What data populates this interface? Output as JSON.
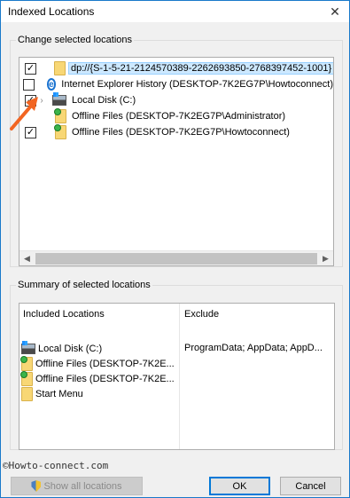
{
  "window": {
    "title": "Indexed Locations",
    "close_glyph": "✕"
  },
  "change_group": {
    "legend": "Change selected locations",
    "items": [
      {
        "checked": true,
        "icon": "folder-icon",
        "label": "dp://{S-1-5-21-2124570389-2262693850-2768397452-1001}",
        "selected": true
      },
      {
        "checked": false,
        "icon": "internet-explorer-icon",
        "label": "Internet Explorer History (DESKTOP-7K2EG7P\\Howtoconnect)"
      },
      {
        "checked": true,
        "icon": "local-disk-icon",
        "label": "Local Disk (C:)",
        "expander": "›"
      },
      {
        "checked": true,
        "icon": "offline-files-icon",
        "label": "Offline Files (DESKTOP-7K2EG7P\\Administrator)"
      },
      {
        "checked": true,
        "icon": "offline-files-icon",
        "label": "Offline Files (DESKTOP-7K2EG7P\\Howtoconnect)"
      }
    ],
    "scroll_left": "◀",
    "scroll_right": "▶"
  },
  "summary_group": {
    "legend": "Summary of selected locations",
    "included_header": "Included Locations",
    "exclude_header": "Exclude",
    "included": [
      {
        "icon": "local-disk-icon",
        "label": "Local Disk (C:)"
      },
      {
        "icon": "offline-files-icon",
        "label": "Offline Files (DESKTOP-7K2E..."
      },
      {
        "icon": "offline-files-icon",
        "label": "Offline Files (DESKTOP-7K2E..."
      },
      {
        "icon": "folder-icon",
        "label": "Start Menu"
      }
    ],
    "exclude_value": "ProgramData; AppData; AppD..."
  },
  "watermark": "©Howto-connect.com",
  "buttons": {
    "show_all": "Show all locations",
    "ok": "OK",
    "cancel": "Cancel"
  },
  "colors": {
    "accent": "#0078d7",
    "selection": "#cce8ff",
    "annotation_arrow": "#f26522"
  }
}
